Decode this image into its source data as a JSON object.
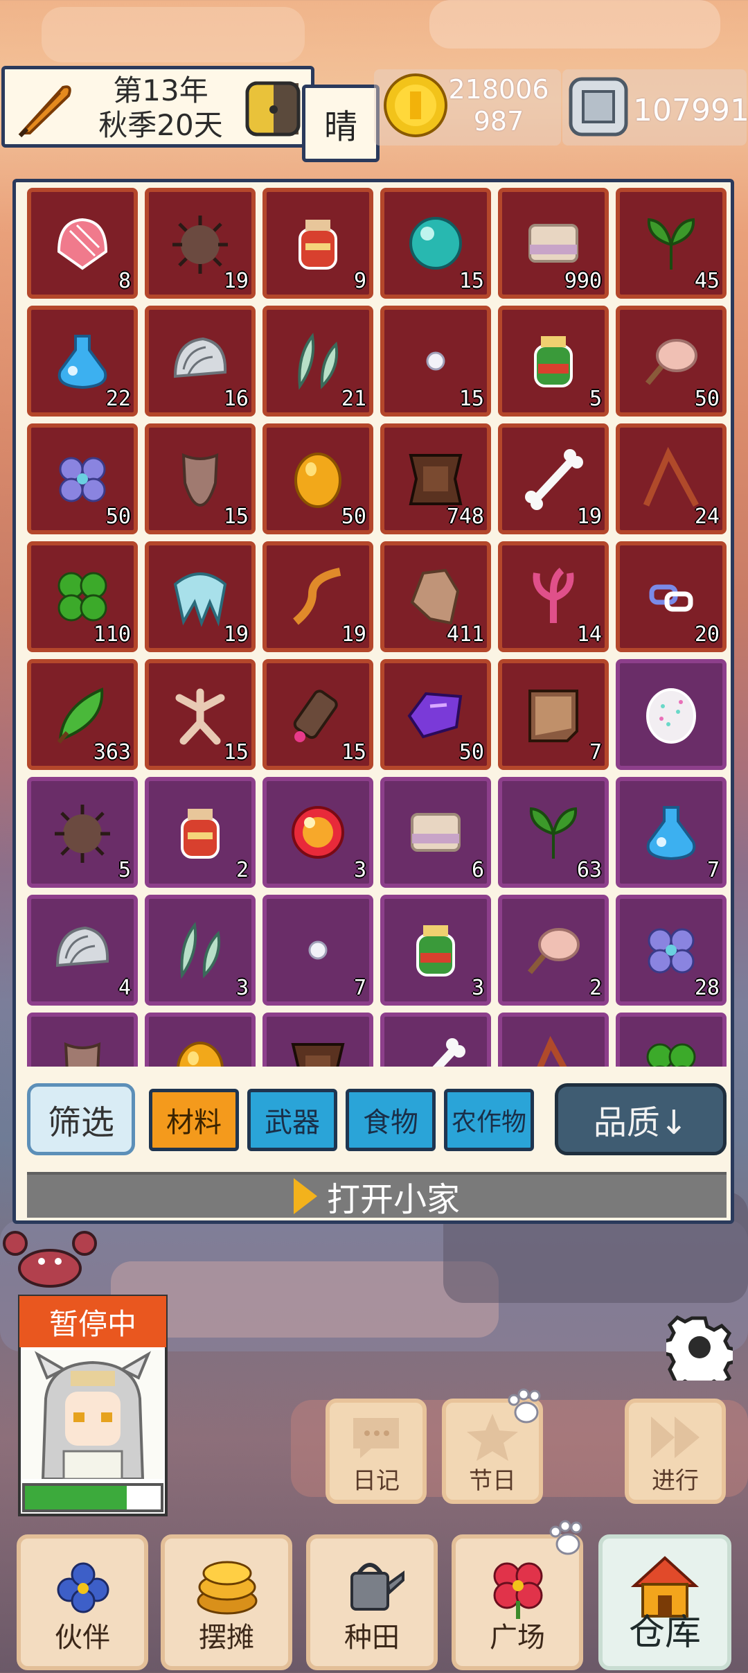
{
  "hud": {
    "date_line1": "第13年",
    "date_line2": "秋季20天",
    "weather": "晴",
    "gold_line1": "218006",
    "gold_line2": "987",
    "gems": "107991"
  },
  "inventory": {
    "rows": [
      [
        {
          "icon": "pink-shell-icon",
          "count": "8",
          "tier": "red"
        },
        {
          "icon": "sea-urchin-icon",
          "count": "19",
          "tier": "red"
        },
        {
          "icon": "red-jar-icon",
          "count": "9",
          "tier": "red"
        },
        {
          "icon": "teal-orb-icon",
          "count": "15",
          "tier": "red"
        },
        {
          "icon": "cloth-bundle-icon",
          "count": "990",
          "tier": "red"
        },
        {
          "icon": "green-leaf-icon",
          "count": "45",
          "tier": "red"
        }
      ],
      [
        {
          "icon": "blue-potion-icon",
          "count": "22",
          "tier": "red"
        },
        {
          "icon": "white-shell-icon",
          "count": "16",
          "tier": "red"
        },
        {
          "icon": "feathers-icon",
          "count": "21",
          "tier": "red"
        },
        {
          "icon": "pearl-icon",
          "count": "15",
          "tier": "red"
        },
        {
          "icon": "green-jar-icon",
          "count": "5",
          "tier": "red"
        },
        {
          "icon": "drumstick-icon",
          "count": "50",
          "tier": "red"
        }
      ],
      [
        {
          "icon": "purple-flower-icon",
          "count": "50",
          "tier": "red"
        },
        {
          "icon": "fur-pelt-icon",
          "count": "15",
          "tier": "red"
        },
        {
          "icon": "amber-egg-icon",
          "count": "50",
          "tier": "red"
        },
        {
          "icon": "leather-icon",
          "count": "748",
          "tier": "red"
        },
        {
          "icon": "bone-icon",
          "count": "19",
          "tier": "red"
        },
        {
          "icon": "branch-icon",
          "count": "24",
          "tier": "red"
        }
      ],
      [
        {
          "icon": "clover-icon",
          "count": "110",
          "tier": "red"
        },
        {
          "icon": "ice-crystal-icon",
          "count": "19",
          "tier": "red"
        },
        {
          "icon": "orange-worm-icon",
          "count": "19",
          "tier": "red"
        },
        {
          "icon": "hide-icon",
          "count": "411",
          "tier": "red"
        },
        {
          "icon": "pink-coral-icon",
          "count": "14",
          "tier": "red"
        },
        {
          "icon": "chain-link-icon",
          "count": "20",
          "tier": "red"
        }
      ],
      [
        {
          "icon": "green-pod-icon",
          "count": "363",
          "tier": "red"
        },
        {
          "icon": "ginseng-root-icon",
          "count": "15",
          "tier": "red"
        },
        {
          "icon": "scroll-tube-icon",
          "count": "15",
          "tier": "red"
        },
        {
          "icon": "amethyst-icon",
          "count": "50",
          "tier": "red"
        },
        {
          "icon": "parchment-icon",
          "count": "7",
          "tier": "red"
        },
        {
          "icon": "sparkle-shell-icon",
          "count": "",
          "tier": "purple"
        }
      ],
      [
        {
          "icon": "sea-urchin-icon",
          "count": "5",
          "tier": "purple"
        },
        {
          "icon": "red-jar-icon",
          "count": "2",
          "tier": "purple"
        },
        {
          "icon": "red-orb-icon",
          "count": "3",
          "tier": "purple"
        },
        {
          "icon": "cloth-bundle-icon",
          "count": "6",
          "tier": "purple"
        },
        {
          "icon": "green-leaf-icon",
          "count": "63",
          "tier": "purple"
        },
        {
          "icon": "blue-potion-icon",
          "count": "7",
          "tier": "purple"
        }
      ],
      [
        {
          "icon": "white-shell-icon",
          "count": "4",
          "tier": "purple"
        },
        {
          "icon": "feathers-icon",
          "count": "3",
          "tier": "purple"
        },
        {
          "icon": "pearl-icon",
          "count": "7",
          "tier": "purple"
        },
        {
          "icon": "green-jar-icon",
          "count": "3",
          "tier": "purple"
        },
        {
          "icon": "drumstick-icon",
          "count": "2",
          "tier": "purple"
        },
        {
          "icon": "purple-flower-icon",
          "count": "28",
          "tier": "purple"
        }
      ],
      [
        {
          "icon": "fur-pelt-icon",
          "count": "",
          "tier": "purple"
        },
        {
          "icon": "amber-egg-icon",
          "count": "",
          "tier": "purple"
        },
        {
          "icon": "leather-icon",
          "count": "",
          "tier": "purple"
        },
        {
          "icon": "bone-icon",
          "count": "",
          "tier": "purple"
        },
        {
          "icon": "branch-icon",
          "count": "",
          "tier": "purple"
        },
        {
          "icon": "clover-icon",
          "count": "",
          "tier": "purple"
        }
      ]
    ]
  },
  "filters": {
    "filter_label": "筛选",
    "categories": [
      "材料",
      "武器",
      "食物",
      "农作物"
    ],
    "active_category": "材料",
    "sort_label": "品质↓",
    "open_home": "打开小家"
  },
  "character": {
    "status": "暂停中",
    "stamina_fraction": 0.75
  },
  "side_buttons": {
    "diary": "日记",
    "festival": "节日",
    "proceed": "进行"
  },
  "nav": {
    "companion": "伙伴",
    "stall": "摆摊",
    "farm": "种田",
    "plaza": "广场",
    "warehouse": "仓库"
  },
  "colors": {
    "slot_red_bg": "#7e1f27",
    "slot_red_border": "#b4472b",
    "slot_purple_bg": "#6a2d68",
    "slot_purple_border": "#8d3f8b",
    "active_category": "#f49a1c",
    "category": "#2aa4d8"
  }
}
